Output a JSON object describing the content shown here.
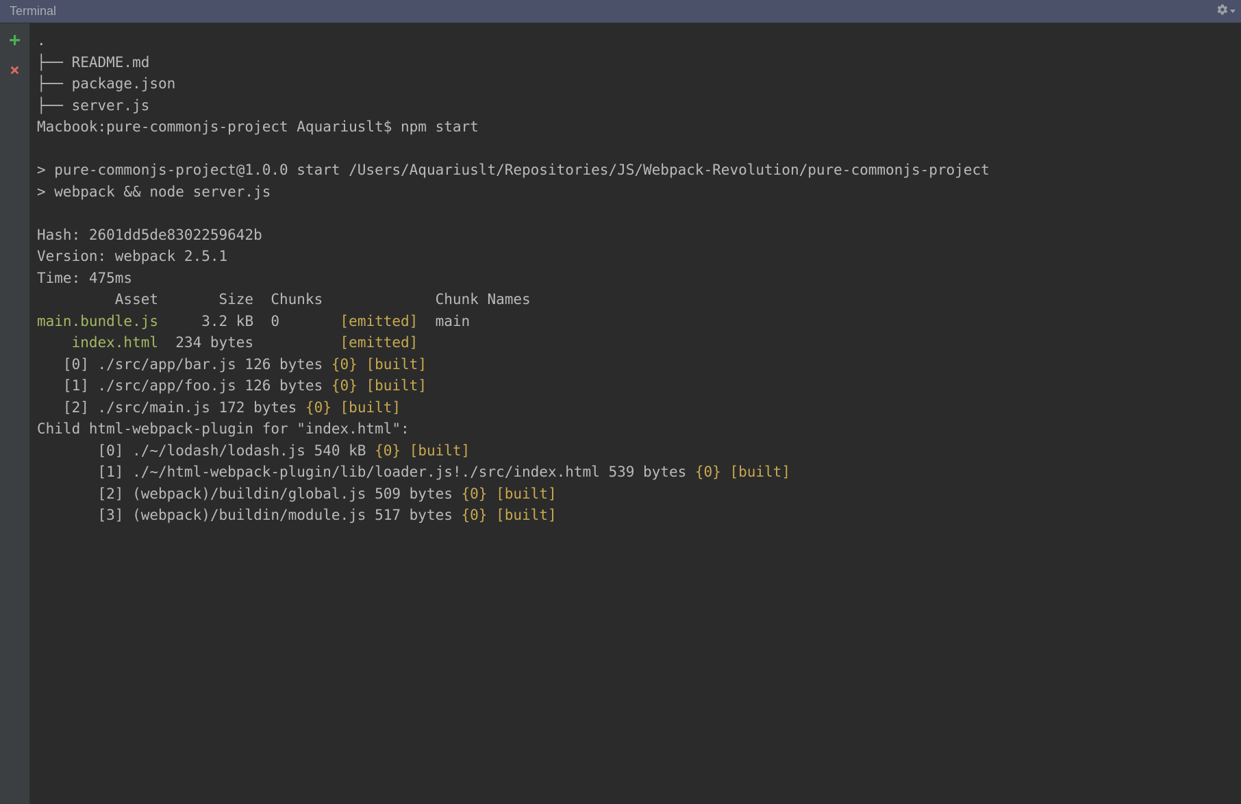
{
  "titlebar": {
    "title": "Terminal"
  },
  "tree": {
    "root": ".",
    "branch": "├──",
    "files": [
      "README.md",
      "package.json",
      "server.js"
    ]
  },
  "prompt": {
    "host": "Macbook",
    "dir": "pure-commonjs-project",
    "user": "Aquariuslt",
    "cmd": "npm start"
  },
  "npm": {
    "line1": "> pure-commonjs-project@1.0.0 start /Users/Aquariuslt/Repositories/JS/Webpack-Revolution/pure-commonjs-project",
    "line2": "> webpack && node server.js"
  },
  "webpack": {
    "hash_label": "Hash:",
    "hash": "2601dd5de8302259642b",
    "version_label": "Version:",
    "version": "webpack 2.5.1",
    "time_label": "Time:",
    "time": "475ms",
    "header": {
      "asset": "Asset",
      "size": "Size",
      "chunks": "Chunks",
      "chunk_names": "Chunk Names"
    },
    "assets": [
      {
        "name": "main.bundle.js",
        "size": "3.2 kB",
        "chunk": "0",
        "flags": "[emitted]",
        "chunk_name": "main"
      },
      {
        "name": "index.html",
        "size": "234 bytes",
        "chunk": "",
        "flags": "[emitted]",
        "chunk_name": ""
      }
    ],
    "modules": [
      {
        "idx": "[0]",
        "path": "./src/app/bar.js",
        "size": "126 bytes",
        "chunk": "{0}",
        "flags": "[built]"
      },
      {
        "idx": "[1]",
        "path": "./src/app/foo.js",
        "size": "126 bytes",
        "chunk": "{0}",
        "flags": "[built]"
      },
      {
        "idx": "[2]",
        "path": "./src/main.js",
        "size": "172 bytes",
        "chunk": "{0}",
        "flags": "[built]"
      }
    ],
    "child_header": "Child html-webpack-plugin for \"index.html\":",
    "child_modules": [
      {
        "idx": "[0]",
        "path": "./~/lodash/lodash.js",
        "size": "540 kB",
        "chunk": "{0}",
        "flags": "[built]"
      },
      {
        "idx": "[1]",
        "path": "./~/html-webpack-plugin/lib/loader.js!./src/index.html",
        "size": "539 bytes",
        "chunk": "{0}",
        "flags": "[built]"
      },
      {
        "idx": "[2]",
        "path": "(webpack)/buildin/global.js",
        "size": "509 bytes",
        "chunk": "{0}",
        "flags": "[built]"
      },
      {
        "idx": "[3]",
        "path": "(webpack)/buildin/module.js",
        "size": "517 bytes",
        "chunk": "{0}",
        "flags": "[built]"
      }
    ]
  }
}
